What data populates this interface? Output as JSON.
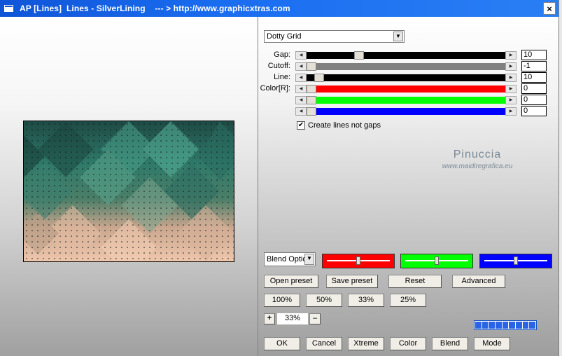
{
  "window": {
    "title": "AP [Lines]  Lines - SilverLining    --- > http://www.graphicxtras.com",
    "close_glyph": "×"
  },
  "controls": {
    "pattern_select": "Dotty Grid",
    "sliders": [
      {
        "label": "Gap:",
        "value": "10",
        "track_color": "#000000",
        "fraction": 0.25
      },
      {
        "label": "Cutoff:",
        "value": "-1",
        "track_color": "#808080",
        "fraction": 0.0
      },
      {
        "label": "Line:",
        "value": "10",
        "track_color": "#000000",
        "fraction": 0.04
      },
      {
        "label": "Color[R]:",
        "value": "0",
        "track_color": "#ff0000",
        "fraction": 0.0
      },
      {
        "label": "",
        "value": "0",
        "track_color": "#00ff00",
        "fraction": 0.0
      },
      {
        "label": "",
        "value": "0",
        "track_color": "#0000ff",
        "fraction": 0.0
      }
    ],
    "checkbox": {
      "label": "Create lines not gaps",
      "checked": true,
      "mark": "✔"
    }
  },
  "watermark": {
    "name": "Pinuccia",
    "url": "www.maidiregrafica.eu"
  },
  "blend": {
    "select": "Blend Optio",
    "sliders": [
      {
        "color": "#ff0000",
        "fraction": 0.5
      },
      {
        "color": "#00ff00",
        "fraction": 0.5
      },
      {
        "color": "#0000ff",
        "fraction": 0.5
      }
    ]
  },
  "buttons": {
    "open_preset": "Open preset",
    "save_preset": "Save preset",
    "reset": "Reset",
    "advanced": "Advanced",
    "zoom": [
      "100%",
      "50%",
      "33%",
      "25%"
    ],
    "zoom_plus": "+",
    "zoom_value": "33%",
    "zoom_minus": "–",
    "ok": "OK",
    "cancel": "Cancel",
    "xtreme": "Xtreme",
    "color": "Color",
    "blend": "Blend",
    "mode": "Mode"
  },
  "progress": {
    "segments": 9,
    "filled": 9
  }
}
